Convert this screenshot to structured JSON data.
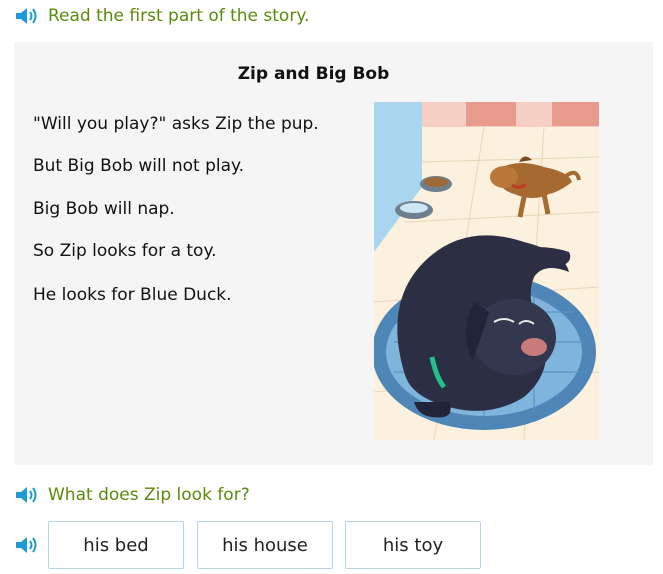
{
  "instruction": {
    "text": "Read the first part of the story."
  },
  "story": {
    "title": "Zip and Big Bob",
    "lines": [
      "\"Will you play?\" asks Zip the pup.",
      "But Big Bob will not play.",
      "Big Bob will nap.",
      "So Zip looks for a toy.",
      "He looks for Blue Duck."
    ]
  },
  "question": {
    "text": "What does Zip look for?"
  },
  "choices": [
    "his bed",
    "his house",
    "his toy"
  ],
  "colors": {
    "prompt_green": "#5c8a0c",
    "speaker_blue": "#1e9ad6",
    "panel_gray": "#f5f5f5",
    "choice_border": "#b8d6e8"
  },
  "icons": {
    "speaker": "speaker-icon"
  }
}
